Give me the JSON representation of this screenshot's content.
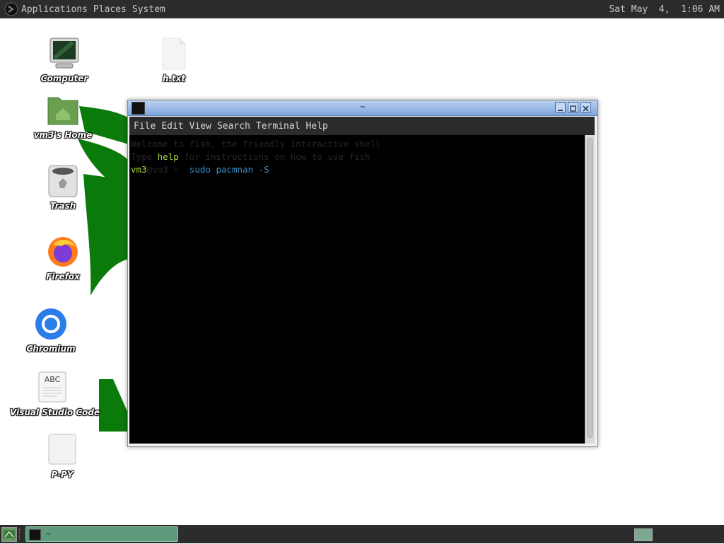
{
  "top_panel": {
    "menus": [
      "Applications",
      "Places",
      "System"
    ],
    "clock": "Sat May  4,  1:06 AM"
  },
  "desktop": {
    "icons": [
      {
        "label": "Computer",
        "icon": "computer-icon"
      },
      {
        "label": "h.txt",
        "icon": "text-file-icon"
      },
      {
        "label": "vm3's Home",
        "icon": "home-folder-icon"
      },
      {
        "label": "Trash",
        "icon": "trash-icon"
      },
      {
        "label": "Firefox",
        "icon": "firefox-icon"
      },
      {
        "label": "Chromium",
        "icon": "chromium-icon"
      },
      {
        "label": "Visual Studio Code",
        "icon": "document-abc-icon"
      },
      {
        "label": "P-PY",
        "icon": "blank-file-icon"
      }
    ],
    "abc_text": "ABC"
  },
  "terminal": {
    "title": "~",
    "menu": [
      "File",
      "Edit",
      "View",
      "Search",
      "Terminal",
      "Help"
    ],
    "lines": {
      "welcome": "Welcome to fish, the friendly interactive shell",
      "type_prefix": "Type ",
      "type_help": "help",
      "type_suffix": " for instructions on how to use fish",
      "prompt_user": "vm3",
      "prompt_host": "@vm3 ~ ",
      "cmd_sudo": "sudo",
      "cmd_rest": "pacmnan -S"
    }
  },
  "bottom_panel": {
    "task_label": "~"
  },
  "colors": {
    "panel_bg": "#2c2c2c",
    "wallpaper_green": "#0a7a0a",
    "terminal_bg": "#000000",
    "prompt_green": "#a7d94b",
    "command_blue": "#3a8fc6"
  }
}
